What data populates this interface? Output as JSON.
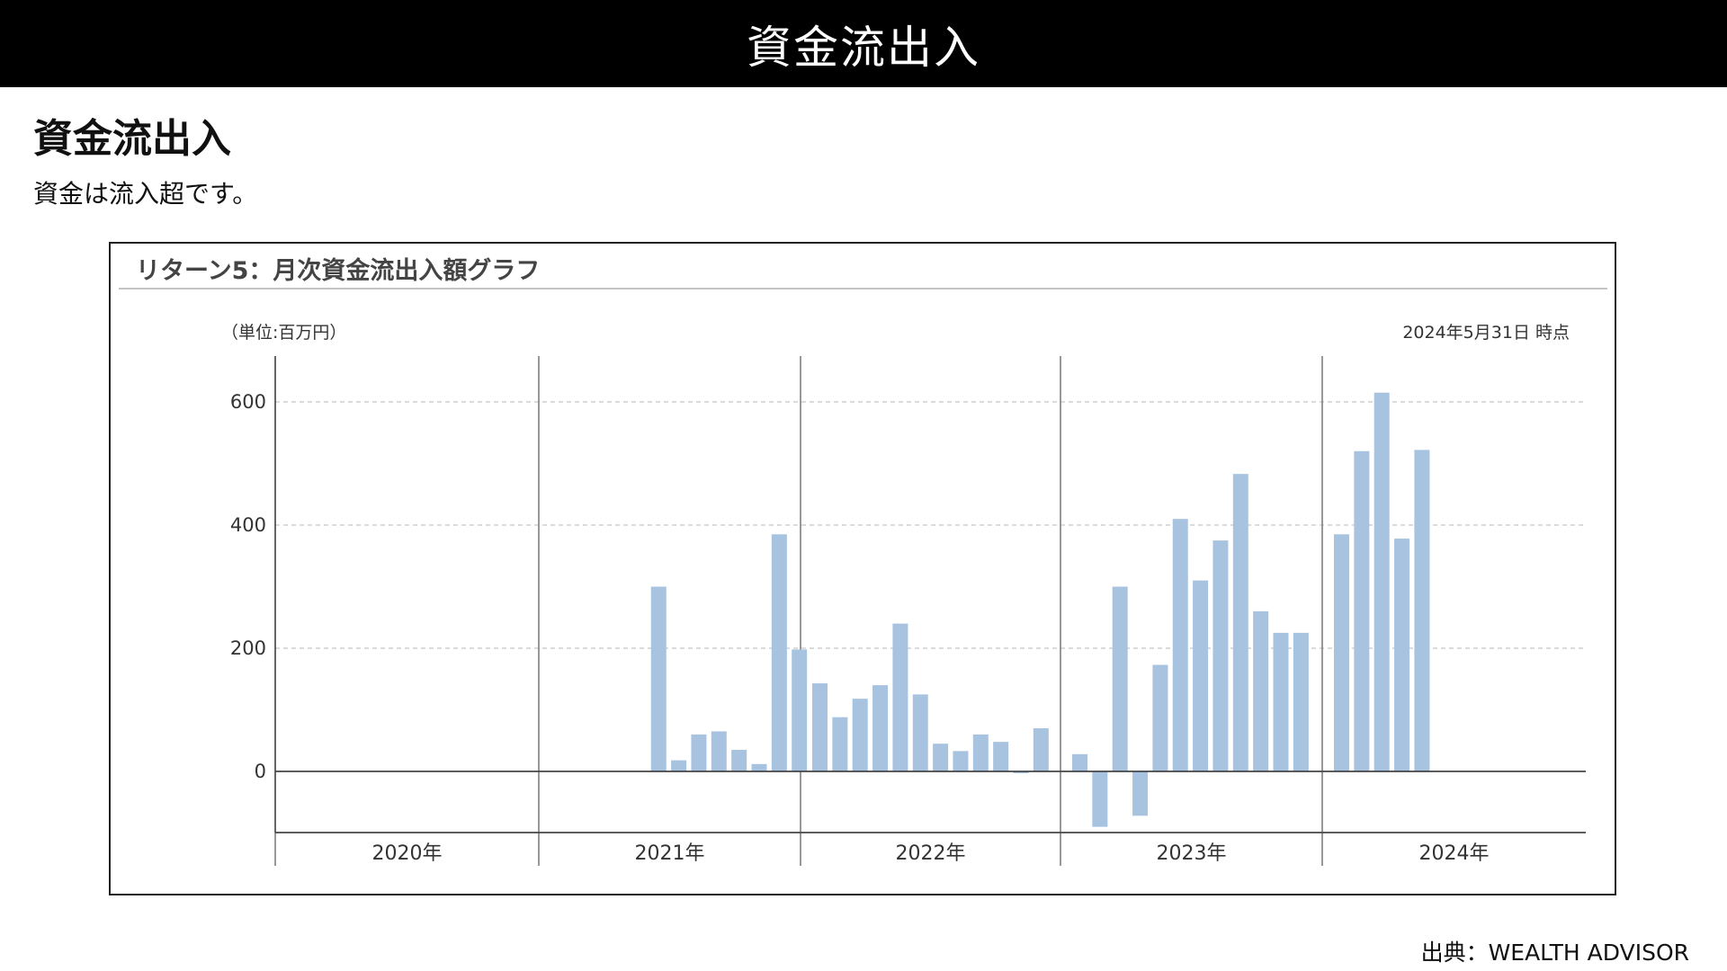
{
  "header": {
    "title": "資金流出入"
  },
  "section": {
    "heading": "資金流出入",
    "description": "資金は流入超です。"
  },
  "chart_panel": {
    "title": "リターン5：月次資金流出入額グラフ",
    "unit_label": "（単位:百万円）",
    "date_label": "2024年5月31日 時点"
  },
  "chart_data": {
    "type": "bar",
    "ylim": [
      -100,
      640
    ],
    "yticks": [
      0,
      200,
      400,
      600
    ],
    "grid": true,
    "bar_color": "#a8c3e0",
    "year_groups": [
      {
        "label": "2020年",
        "values": []
      },
      {
        "label": "2021年",
        "values": [
          null,
          null,
          null,
          null,
          null,
          300,
          18,
          60,
          65,
          35,
          12,
          385,
          198
        ]
      },
      {
        "label": "2022年",
        "values": [
          143,
          88,
          118,
          140,
          240,
          125,
          45,
          33,
          60,
          48,
          -3,
          70
        ]
      },
      {
        "label": "2023年",
        "values": [
          28,
          -90,
          300,
          -72,
          173,
          410,
          310,
          375,
          483,
          260,
          225,
          225
        ]
      },
      {
        "label": "2024年",
        "values": [
          385,
          520,
          615,
          378,
          522
        ]
      }
    ]
  },
  "footer": {
    "source": "出典：WEALTH ADVISOR"
  }
}
